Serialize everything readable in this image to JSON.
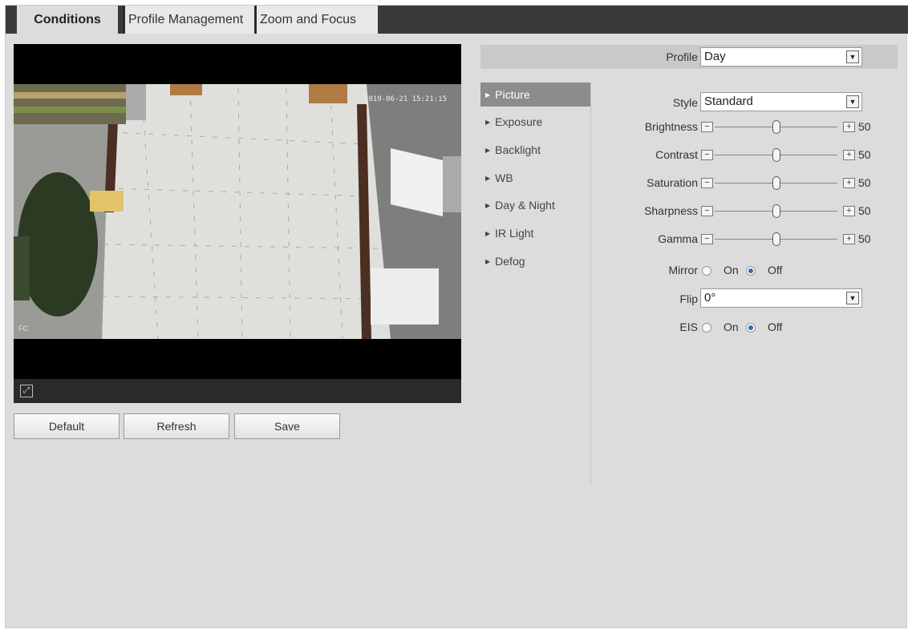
{
  "tabs": [
    {
      "label": "Conditions",
      "active": true
    },
    {
      "label": "Profile Management",
      "active": false
    },
    {
      "label": "Zoom and Focus",
      "active": false
    }
  ],
  "video": {
    "timestamp": "2019-06-21 15:21:15",
    "corner_tag": "FC",
    "fullscreen_icon": "expand-icon"
  },
  "buttons": {
    "default": "Default",
    "refresh": "Refresh",
    "save": "Save"
  },
  "profile": {
    "label": "Profile",
    "value": "Day"
  },
  "menu": [
    {
      "label": "Picture",
      "active": true
    },
    {
      "label": "Exposure",
      "active": false
    },
    {
      "label": "Backlight",
      "active": false
    },
    {
      "label": "WB",
      "active": false
    },
    {
      "label": "Day & Night",
      "active": false
    },
    {
      "label": "IR Light",
      "active": false
    },
    {
      "label": "Defog",
      "active": false
    }
  ],
  "picture": {
    "style": {
      "label": "Style",
      "value": "Standard"
    },
    "sliders": [
      {
        "label": "Brightness",
        "value": 50
      },
      {
        "label": "Contrast",
        "value": 50
      },
      {
        "label": "Saturation",
        "value": 50
      },
      {
        "label": "Sharpness",
        "value": 50
      },
      {
        "label": "Gamma",
        "value": 50
      }
    ],
    "mirror": {
      "label": "Mirror",
      "on": "On",
      "off": "Off",
      "selected": "Off"
    },
    "flip": {
      "label": "Flip",
      "value": "0°"
    },
    "eis": {
      "label": "EIS",
      "on": "On",
      "off": "Off",
      "selected": "Off"
    }
  },
  "colors": {
    "accent": "#2f6db5",
    "active_menu": "#8c8c8c",
    "tab_bar": "#3a3a3a"
  }
}
